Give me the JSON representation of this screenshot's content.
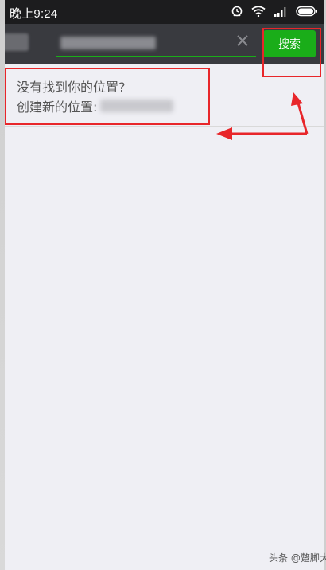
{
  "status_bar": {
    "time": "晚上9:24",
    "icons": [
      "alarm-icon",
      "wifi-icon",
      "signal-icon",
      "battery-icon"
    ]
  },
  "search_bar": {
    "clear_icon": "close-icon",
    "button_label": "搜索"
  },
  "results": {
    "prompt_line1": "没有找到你的位置?",
    "prompt_line2_label": "创建新的位置:"
  },
  "colors": {
    "accent_green": "#1aad19",
    "header_dark": "#393a3f",
    "status_bar": "#1c1c1e",
    "background": "#efeff4",
    "annotation_red": "#e8262a"
  },
  "watermark": "头条 @蹩脚大王"
}
